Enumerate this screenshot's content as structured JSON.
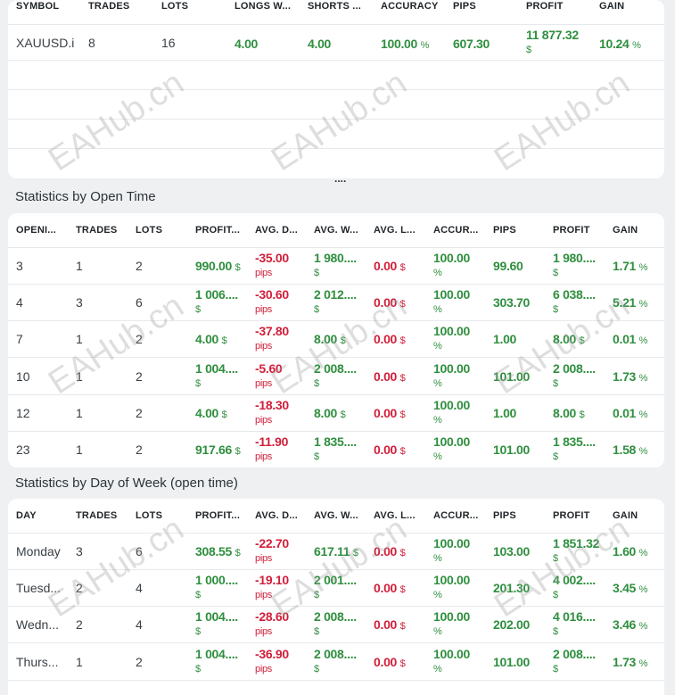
{
  "symbols": {
    "headers": [
      "SYMBOL",
      "TRADES",
      "LOTS",
      "LONGS W...",
      "SHORTS ...",
      "ACCURACY",
      "PIPS",
      "PROFIT",
      "GAIN"
    ],
    "rows": [
      {
        "symbol": "XAUUSD.i",
        "trades": "8",
        "lots": "16",
        "longs": "4.00",
        "shorts": "4.00",
        "accuracy": "100.00",
        "accuracy_unit": "%",
        "pips": "607.30",
        "profit": "11 877.32",
        "profit_unit": "$",
        "gain": "10.24",
        "gain_unit": "%"
      }
    ],
    "more": "...."
  },
  "open_time": {
    "title": "Statistics by Open Time",
    "headers": [
      "OPENI...",
      "TRADES",
      "LOTS",
      "PROFIT...",
      "AVG. D...",
      "AVG. W...",
      "AVG. L...",
      "ACCUR...",
      "PIPS",
      "PROFIT",
      "GAIN"
    ],
    "rows": [
      {
        "key": "3",
        "trades": "1",
        "lots": "2",
        "profit": "990.00",
        "profit_unit": "$",
        "avg_d": "-35.00",
        "avg_d_unit": "pips",
        "avg_w": "1 980....",
        "avg_w_unit": "$",
        "avg_l": "0.00",
        "avg_l_unit": "$",
        "accuracy": "100.00",
        "accuracy_unit": "%",
        "pips": "99.60",
        "profit2": "1 980....",
        "profit2_unit": "$",
        "gain": "1.71",
        "gain_unit": "%"
      },
      {
        "key": "4",
        "trades": "3",
        "lots": "6",
        "profit": "1 006....",
        "profit_unit": "$",
        "avg_d": "-30.60",
        "avg_d_unit": "pips",
        "avg_w": "2 012....",
        "avg_w_unit": "$",
        "avg_l": "0.00",
        "avg_l_unit": "$",
        "accuracy": "100.00",
        "accuracy_unit": "%",
        "pips": "303.70",
        "profit2": "6 038....",
        "profit2_unit": "$",
        "gain": "5.21",
        "gain_unit": "%"
      },
      {
        "key": "7",
        "trades": "1",
        "lots": "2",
        "profit": "4.00",
        "profit_unit": "$",
        "avg_d": "-37.80",
        "avg_d_unit": "pips",
        "avg_w": "8.00",
        "avg_w_unit": "$",
        "avg_l": "0.00",
        "avg_l_unit": "$",
        "accuracy": "100.00",
        "accuracy_unit": "%",
        "pips": "1.00",
        "profit2": "8.00",
        "profit2_unit": "$",
        "gain": "0.01",
        "gain_unit": "%"
      },
      {
        "key": "10",
        "trades": "1",
        "lots": "2",
        "profit": "1 004....",
        "profit_unit": "$",
        "avg_d": "-5.60",
        "avg_d_unit": "pips",
        "avg_w": "2 008....",
        "avg_w_unit": "$",
        "avg_l": "0.00",
        "avg_l_unit": "$",
        "accuracy": "100.00",
        "accuracy_unit": "%",
        "pips": "101.00",
        "profit2": "2 008....",
        "profit2_unit": "$",
        "gain": "1.73",
        "gain_unit": "%"
      },
      {
        "key": "12",
        "trades": "1",
        "lots": "2",
        "profit": "4.00",
        "profit_unit": "$",
        "avg_d": "-18.30",
        "avg_d_unit": "pips",
        "avg_w": "8.00",
        "avg_w_unit": "$",
        "avg_l": "0.00",
        "avg_l_unit": "$",
        "accuracy": "100.00",
        "accuracy_unit": "%",
        "pips": "1.00",
        "profit2": "8.00",
        "profit2_unit": "$",
        "gain": "0.01",
        "gain_unit": "%"
      },
      {
        "key": "23",
        "trades": "1",
        "lots": "2",
        "profit": "917.66",
        "profit_unit": "$",
        "avg_d": "-11.90",
        "avg_d_unit": "pips",
        "avg_w": "1 835....",
        "avg_w_unit": "$",
        "avg_l": "0.00",
        "avg_l_unit": "$",
        "accuracy": "100.00",
        "accuracy_unit": "%",
        "pips": "101.00",
        "profit2": "1 835....",
        "profit2_unit": "$",
        "gain": "1.58",
        "gain_unit": "%"
      }
    ]
  },
  "day_of_week": {
    "title": "Statistics by Day of Week (open time)",
    "headers": [
      "DAY",
      "TRADES",
      "LOTS",
      "PROFIT...",
      "AVG. D...",
      "AVG. W...",
      "AVG. L...",
      "ACCUR...",
      "PIPS",
      "PROFIT",
      "GAIN"
    ],
    "rows": [
      {
        "key": "Monday",
        "trades": "3",
        "lots": "6",
        "profit": "308.55",
        "profit_unit": "$",
        "avg_d": "-22.70",
        "avg_d_unit": "pips",
        "avg_w": "617.11",
        "avg_w_unit": "$",
        "avg_l": "0.00",
        "avg_l_unit": "$",
        "accuracy": "100.00",
        "accuracy_unit": "%",
        "pips": "103.00",
        "profit2": "1 851.32",
        "profit2_unit": "$",
        "gain": "1.60",
        "gain_unit": "%"
      },
      {
        "key": "Tuesd...",
        "trades": "2",
        "lots": "4",
        "profit": "1 000....",
        "profit_unit": "$",
        "avg_d": "-19.10",
        "avg_d_unit": "pips",
        "avg_w": "2 001....",
        "avg_w_unit": "$",
        "avg_l": "0.00",
        "avg_l_unit": "$",
        "accuracy": "100.00",
        "accuracy_unit": "%",
        "pips": "201.30",
        "profit2": "4 002....",
        "profit2_unit": "$",
        "gain": "3.45",
        "gain_unit": "%"
      },
      {
        "key": "Wedn...",
        "trades": "2",
        "lots": "4",
        "profit": "1 004....",
        "profit_unit": "$",
        "avg_d": "-28.60",
        "avg_d_unit": "pips",
        "avg_w": "2 008....",
        "avg_w_unit": "$",
        "avg_l": "0.00",
        "avg_l_unit": "$",
        "accuracy": "100.00",
        "accuracy_unit": "%",
        "pips": "202.00",
        "profit2": "4 016....",
        "profit2_unit": "$",
        "gain": "3.46",
        "gain_unit": "%"
      },
      {
        "key": "Thurs...",
        "trades": "1",
        "lots": "2",
        "profit": "1 004....",
        "profit_unit": "$",
        "avg_d": "-36.90",
        "avg_d_unit": "pips",
        "avg_w": "2 008....",
        "avg_w_unit": "$",
        "avg_l": "0.00",
        "avg_l_unit": "$",
        "accuracy": "100.00",
        "accuracy_unit": "%",
        "pips": "101.00",
        "profit2": "2 008....",
        "profit2_unit": "$",
        "gain": "1.73",
        "gain_unit": "%"
      }
    ]
  },
  "watermark": "EAHub.cn"
}
